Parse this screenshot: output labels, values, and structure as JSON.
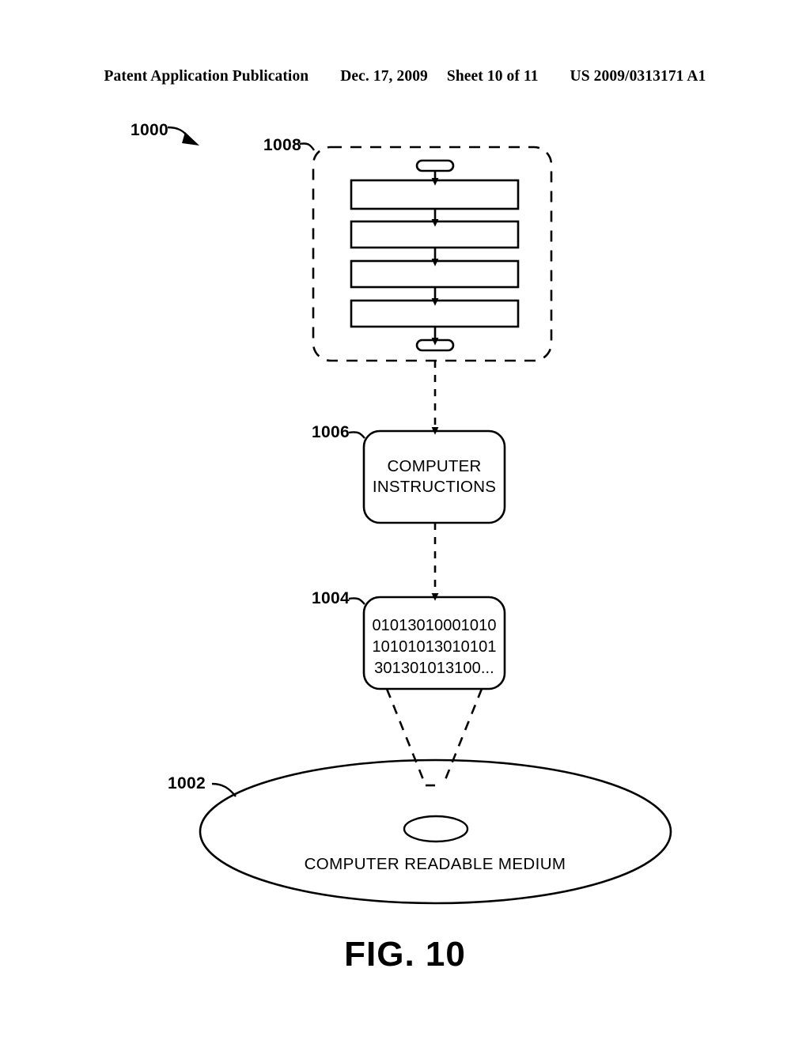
{
  "header": {
    "publication": "Patent Application Publication",
    "date": "Dec. 17, 2009",
    "sheet": "Sheet 10 of 11",
    "patent_number": "US 2009/0313171 A1"
  },
  "figure": {
    "caption": "FIG. 10",
    "overall_ref": "1000",
    "flowchart_group_ref": "1008",
    "instructions_ref": "1006",
    "instructions_label_line1": "COMPUTER",
    "instructions_label_line2": "INSTRUCTIONS",
    "encoded_data_ref": "1004",
    "encoded_data_line1": "01013010001010",
    "encoded_data_line2": "10101013010101",
    "encoded_data_line3": "301301013100...",
    "medium_ref": "1002",
    "medium_label": "COMPUTER READABLE MEDIUM",
    "flowchart_steps": [
      "",
      "",
      "",
      ""
    ],
    "flowchart_terminator_start": "",
    "flowchart_terminator_end": ""
  },
  "colors": {
    "ink": "#000000",
    "paper": "#ffffff"
  }
}
